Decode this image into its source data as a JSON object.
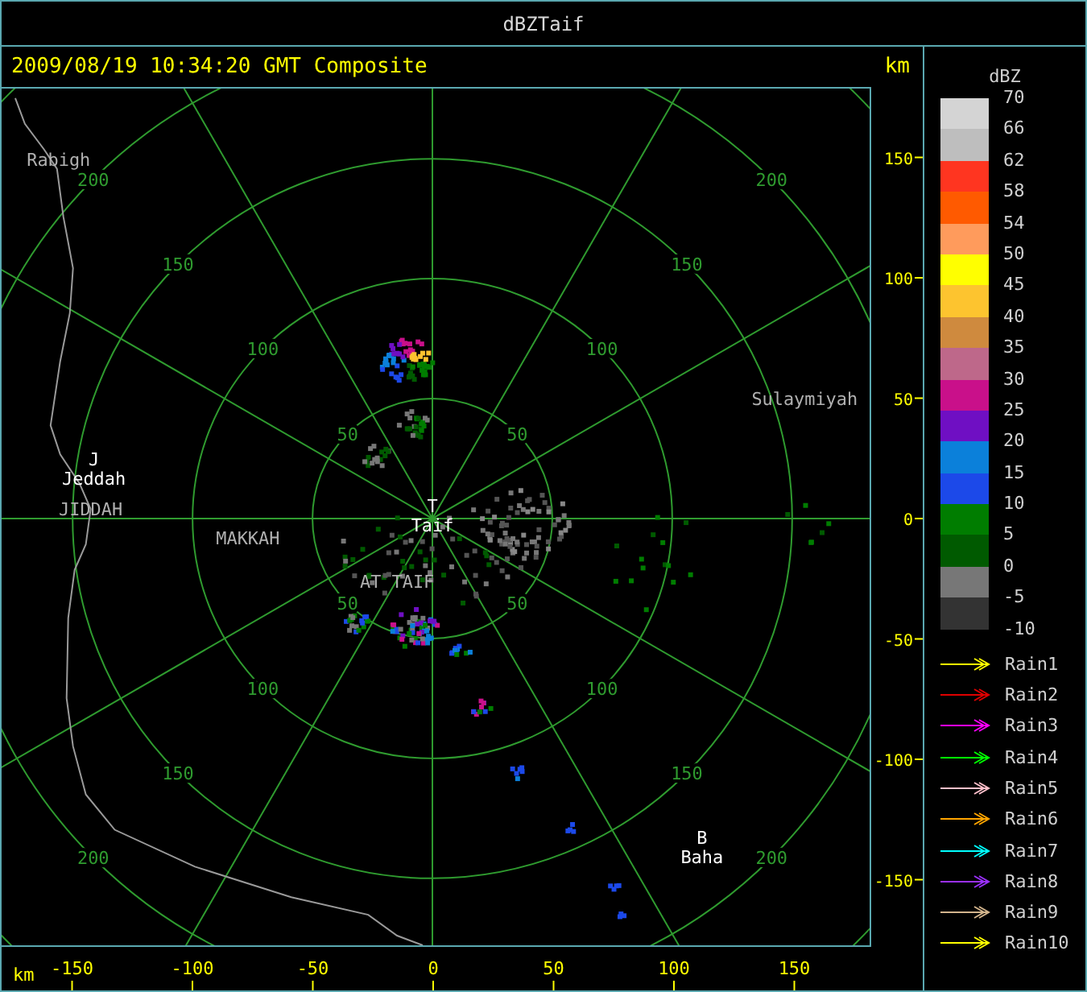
{
  "window": {
    "title": "dBZTaif"
  },
  "header": {
    "caption": "2009/08/19 10:34:20 GMT Composite",
    "unit": "km"
  },
  "range_rings": [
    {
      "labels": [
        "50",
        "50",
        "50",
        "50"
      ]
    },
    {
      "labels": [
        "100",
        "100",
        "100",
        "100"
      ]
    },
    {
      "labels": [
        "150",
        "150",
        "150",
        "150"
      ]
    },
    {
      "labels": [
        "200",
        "200",
        "200",
        "200"
      ]
    }
  ],
  "places": [
    {
      "name": "Rabigh",
      "kind": "place"
    },
    {
      "name": "Jeddah",
      "marker": "J",
      "kind": "station"
    },
    {
      "name": "JIDDAH",
      "kind": "place"
    },
    {
      "name": "MAKKAH",
      "kind": "place"
    },
    {
      "name": "Taif",
      "marker": "T",
      "kind": "station"
    },
    {
      "name": "AT TAIF",
      "kind": "place"
    },
    {
      "name": "Sulaymiyah",
      "kind": "place"
    },
    {
      "name": "Baha",
      "marker": "B",
      "kind": "station"
    }
  ],
  "y_axis": {
    "ticks": [
      "150",
      "100",
      "50",
      "0",
      "-50",
      "-100",
      "-150"
    ]
  },
  "x_axis": {
    "unit": "km",
    "ticks": [
      "-150",
      "-100",
      "-50",
      "0",
      "50",
      "100",
      "150"
    ]
  },
  "legend": {
    "title": "dBZ",
    "bands": [
      {
        "label": "70",
        "color": "#d4d4d4"
      },
      {
        "label": "66",
        "color": "#bebebe"
      },
      {
        "label": "62",
        "color": "#ff3520"
      },
      {
        "label": "58",
        "color": "#ff5a00"
      },
      {
        "label": "54",
        "color": "#ff9b5c"
      },
      {
        "label": "50",
        "color": "#ffff00"
      },
      {
        "label": "45",
        "color": "#fdc42f"
      },
      {
        "label": "40",
        "color": "#cf8a3e"
      },
      {
        "label": "35",
        "color": "#be688a"
      },
      {
        "label": "30",
        "color": "#c9108a"
      },
      {
        "label": "25",
        "color": "#6f0fc3"
      },
      {
        "label": "20",
        "color": "#0b80da"
      },
      {
        "label": "15",
        "color": "#1c49e9"
      },
      {
        "label": "10",
        "color": "#007d00"
      },
      {
        "label": "5",
        "color": "#005a00"
      },
      {
        "label": "0",
        "color": "#777777"
      },
      {
        "label": "-5",
        "color": "#333333"
      }
    ],
    "end_label": "-10",
    "tracks": [
      {
        "label": "Rain1",
        "color": "#ffff00"
      },
      {
        "label": "Rain2",
        "color": "#e00000"
      },
      {
        "label": "Rain3",
        "color": "#ff00ff"
      },
      {
        "label": "Rain4",
        "color": "#00ff00"
      },
      {
        "label": "Rain5",
        "color": "#ffc0cb"
      },
      {
        "label": "Rain6",
        "color": "#ffa500"
      },
      {
        "label": "Rain7",
        "color": "#00ffff"
      },
      {
        "label": "Rain8",
        "color": "#9b30ff"
      },
      {
        "label": "Rain9",
        "color": "#d2b48c"
      },
      {
        "label": "Rain10",
        "color": "#ffff00"
      }
    ]
  }
}
